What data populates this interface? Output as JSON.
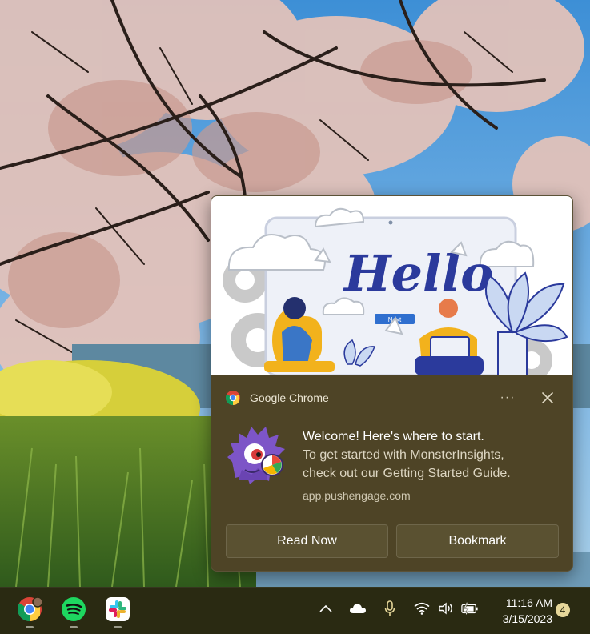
{
  "notification": {
    "app_name": "Google Chrome",
    "more_label": "···",
    "hero_text": "Hello",
    "hero_button": "Next",
    "title": "Welcome! Here's where to start.",
    "description_line1": "To get started with MonsterInsights,",
    "description_line2": "check out our Getting Started Guide.",
    "source": "app.pushengage.com",
    "actions": [
      {
        "label": "Read Now"
      },
      {
        "label": "Bookmark"
      }
    ]
  },
  "taskbar": {
    "apps": [
      {
        "name": "chrome-icon"
      },
      {
        "name": "spotify-icon"
      },
      {
        "name": "slack-icon"
      }
    ],
    "tray": [
      "chevron-up-icon",
      "cloud-icon",
      "microphone-icon",
      "wifi-icon",
      "volume-icon",
      "battery-icon"
    ],
    "time": "11:16 AM",
    "date": "3/15/2023",
    "notification_count": "4"
  },
  "colors": {
    "toast_bg": "#4e4426",
    "button_bg": "#5a5131",
    "taskbar_bg": "#2a2a12",
    "badge_bg": "#e6d79a"
  }
}
